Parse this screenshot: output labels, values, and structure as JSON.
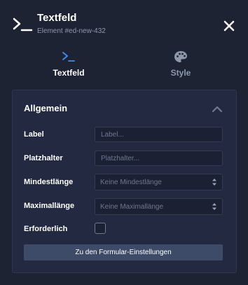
{
  "header": {
    "title": "Textfeld",
    "subtitle": "Element #ed-new-432",
    "icon": "terminal-icon",
    "close_icon": "close-icon"
  },
  "tabs": [
    {
      "label": "Textfeld",
      "icon": "terminal-icon",
      "active": true
    },
    {
      "label": "Style",
      "icon": "palette-icon",
      "active": false
    }
  ],
  "section": {
    "title": "Allgemein",
    "collapse_icon": "chevron-up-icon"
  },
  "fields": {
    "label": {
      "label": "Label",
      "placeholder": "Label...",
      "value": ""
    },
    "placeholder": {
      "label": "Platzhalter",
      "placeholder": "Platzhalter...",
      "value": ""
    },
    "min_length": {
      "label": "Mindestlänge",
      "selected": "Keine Mindestlänge"
    },
    "max_length": {
      "label": "Maximallänge",
      "selected": "Keine Maximallänge"
    },
    "required": {
      "label": "Erforderlich",
      "checked": false
    }
  },
  "form_settings_button": "Zu den Formular-Einstellungen",
  "colors": {
    "background": "#1d2333",
    "panel": "#222940",
    "accent": "#3d8bfd",
    "button": "#3d4a68"
  }
}
